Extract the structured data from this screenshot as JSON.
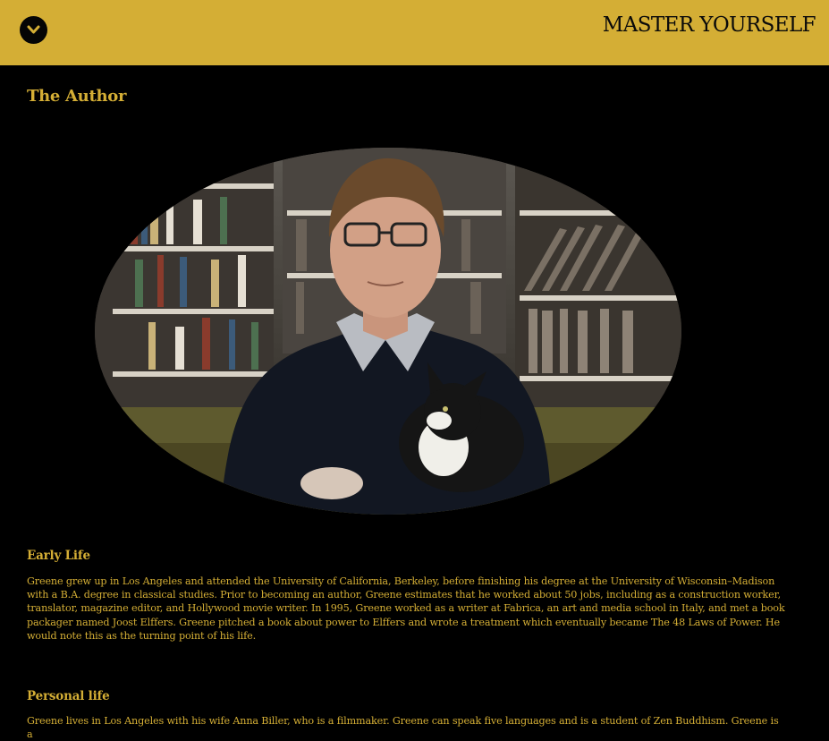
{
  "header": {
    "brand": "MASTER YOURSELF",
    "menu_icon": "chevron-down-icon"
  },
  "colors": {
    "accent": "#D4AE35",
    "background": "#000000",
    "header_text": "#0A0A0A"
  },
  "page": {
    "title": "The Author",
    "portrait_icon": "author-portrait-photo"
  },
  "sections": [
    {
      "heading": "Early Life",
      "body": "Greene grew up in Los Angeles and attended the University of California, Berkeley, before finishing his degree at the University of Wisconsin–Madison with a B.A. degree in classical studies. Prior to becoming an author, Greene estimates that he worked about 50 jobs, including as a construction worker, translator, magazine editor, and Hollywood movie writer. In 1995, Greene worked as a writer at Fabrica, an art and media school in Italy, and met a book packager named Joost Elffers. Greene pitched a book about power to Elffers and wrote a treatment which eventually became The 48 Laws of Power. He would note this as the turning point of his life."
    },
    {
      "heading": "Personal life",
      "body": "Greene lives in Los Angeles with his wife Anna Biller, who is a filmmaker. Greene can speak five languages and is a student of Zen Buddhism. Greene is a"
    }
  ]
}
